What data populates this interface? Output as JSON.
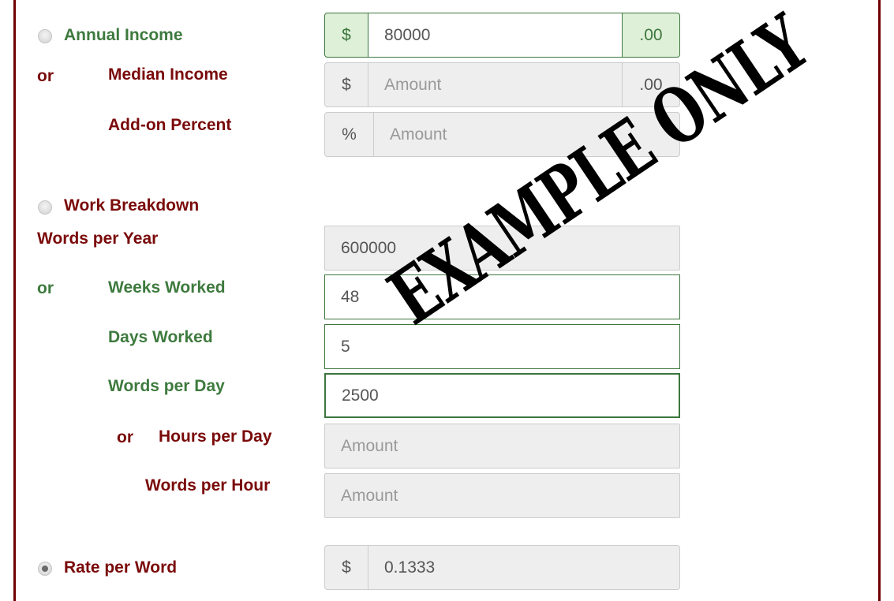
{
  "colors": {
    "frame": "#6f0000",
    "label_red": "#7a0a0a",
    "label_green": "#3e7a3e",
    "valid_border": "#3c763d",
    "valid_addon_bg": "#dff0d8"
  },
  "income": {
    "annual_label": "Annual Income",
    "annual_selected": false,
    "annual_prefix": "$",
    "annual_value": "80000",
    "annual_suffix": ".00",
    "or_label": "or",
    "median_label": "Median Income",
    "median_prefix": "$",
    "median_placeholder": "Amount",
    "median_suffix": ".00",
    "addon_label": "Add-on Percent",
    "addon_prefix": "%",
    "addon_placeholder": "Amount"
  },
  "work": {
    "breakdown_label": "Work Breakdown",
    "breakdown_selected": false,
    "words_per_year_label": "Words per Year",
    "words_per_year_value": "600000",
    "or_label": "or",
    "weeks_label": "Weeks Worked",
    "weeks_value": "48",
    "days_label": "Days Worked",
    "days_value": "5",
    "words_per_day_label": "Words per Day",
    "words_per_day_value": "2500",
    "or2_label": "or",
    "hours_label": "Hours per Day",
    "hours_placeholder": "Amount",
    "words_per_hour_label": "Words per Hour",
    "words_per_hour_placeholder": "Amount"
  },
  "rate": {
    "label": "Rate per Word",
    "selected": true,
    "prefix": "$",
    "value": "0.1333"
  },
  "watermark": "EXAMPLE ONLY"
}
